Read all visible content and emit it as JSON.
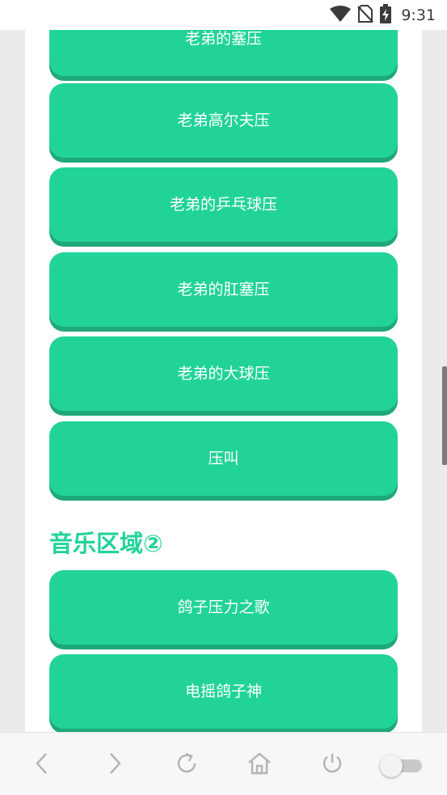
{
  "status_bar": {
    "time": "9:31",
    "icons": [
      "wifi-icon",
      "no-sim-icon",
      "battery-charging-icon"
    ]
  },
  "sound_buttons": [
    {
      "label": "老弟的塞压"
    },
    {
      "label": "老弟高尔夫压"
    },
    {
      "label": "老弟的乒乓球压"
    },
    {
      "label": "老弟的肛塞压"
    },
    {
      "label": "老弟的大球压"
    },
    {
      "label": "压叫"
    }
  ],
  "music_section": {
    "title": "音乐区域②",
    "buttons": [
      {
        "label": "鸽子压力之歌"
      },
      {
        "label": "电摇鸽子神"
      }
    ]
  },
  "nav_bar": {
    "icons": [
      "back-icon",
      "forward-icon",
      "refresh-icon",
      "home-icon",
      "power-icon",
      "toggle-switch"
    ]
  },
  "colors": {
    "accent": "#22d399",
    "accent_shadow": "#1fa879",
    "background": "#ebebeb"
  }
}
